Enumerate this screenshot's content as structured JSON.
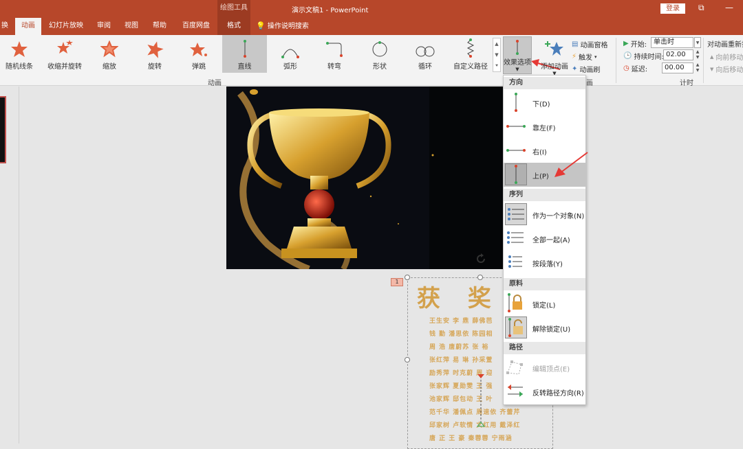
{
  "titlebar": {
    "context_tab": "绘图工具",
    "doc_title": "演示文稿1  -  PowerPoint",
    "login": "登录",
    "restore_icon": "ribbon-display-icon",
    "minimize_icon": "minimize-icon"
  },
  "tabs": [
    {
      "label": "换"
    },
    {
      "label": "动画"
    },
    {
      "label": "幻灯片放映"
    },
    {
      "label": "审阅"
    },
    {
      "label": "视图"
    },
    {
      "label": "帮助"
    },
    {
      "label": "百度网盘"
    },
    {
      "label": "格式"
    },
    {
      "label": "操作说明搜索"
    }
  ],
  "ribbon": {
    "gallery": [
      {
        "label": "随机线条"
      },
      {
        "label": "收缩并旋转"
      },
      {
        "label": "缩放"
      },
      {
        "label": "旋转"
      },
      {
        "label": "弹跳"
      },
      {
        "label": "直线"
      },
      {
        "label": "弧形"
      },
      {
        "label": "转弯"
      },
      {
        "label": "形状"
      },
      {
        "label": "循环"
      },
      {
        "label": "自定义路径"
      }
    ],
    "effect_options": "效果选项",
    "add_animation": "添加动画",
    "animation_pane": "动画窗格",
    "trigger": "触发",
    "animation_painter": "动画刷",
    "group_animation": "动画",
    "group_advanced_tail": "画",
    "start_label": "开始:",
    "start_value": "单击时",
    "duration_label": "持续时间:",
    "duration_value": "02.00",
    "delay_label": "延迟:",
    "delay_value": "00.00",
    "reorder_title": "对动画重新排",
    "move_earlier": "向前移动",
    "move_later": "向后移动",
    "group_timing": "计时"
  },
  "slide": {
    "animation_tag": "1",
    "award_title": "获 奖 名",
    "name_rows": [
      "王生安  李    鼎  薛佛芭",
      "钱    勤  潘思依  陈园相",
      "周    浩  唐蔚苏  张    裕",
      "张红萍  易    琳  孙采萱",
      "励秀萍  时克蔚  周    迎",
      "张家辉  夏勋雯  王    强",
      "池家辉  邸包动  王    叶",
      "范千华  潘佩点  周速依  齐蕾芹",
      "邱家树  卢软情  文红用  戴泽红",
      "唐    正  王    豪  秦蓉蓉  宁雨涵"
    ]
  },
  "menu": {
    "direction_header": "方向",
    "direction_items": [
      "下(D)",
      "靠左(F)",
      "右(I)",
      "上(P)"
    ],
    "sequence_header": "序列",
    "sequence_items": [
      "作为一个对象(N)",
      "全部一起(A)",
      "按段落(Y)"
    ],
    "origin_header": "原料",
    "origin_items": [
      "锁定(L)",
      "解除锁定(U)"
    ],
    "path_header": "路径",
    "path_items": [
      "编辑顶点(E)",
      "反转路径方向(R)"
    ]
  },
  "colors": {
    "accent": "#b7472a",
    "accent_dark": "#9c3b22",
    "highlight": "#c5c5c5",
    "arrow": "#e53935",
    "gold": "#d3a14c"
  }
}
